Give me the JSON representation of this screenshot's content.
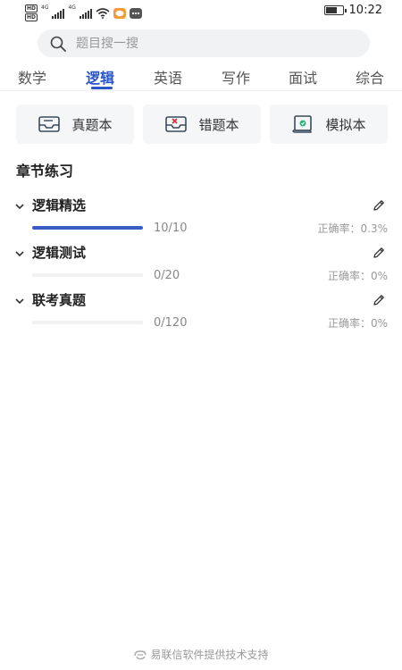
{
  "status_bar": {
    "hd1": "HD",
    "hd2": "HD",
    "net1": "4G",
    "net2": "4G",
    "time": "10:22",
    "battery_level": 0.7,
    "icons": [
      "signal-icon",
      "wifi-icon",
      "message-app-icon",
      "chat-app-icon",
      "battery-icon"
    ]
  },
  "search": {
    "placeholder": "题目搜一搜"
  },
  "tabs": [
    {
      "label": "数学",
      "active": false
    },
    {
      "label": "逻辑",
      "active": true
    },
    {
      "label": "英语",
      "active": false
    },
    {
      "label": "写作",
      "active": false
    },
    {
      "label": "面试",
      "active": false
    },
    {
      "label": "综合",
      "active": false
    }
  ],
  "quick_actions": [
    {
      "label": "真题本",
      "icon": "inbox-icon"
    },
    {
      "label": "错题本",
      "icon": "error-inbox-icon"
    },
    {
      "label": "模拟本",
      "icon": "scroll-icon"
    }
  ],
  "section_title": "章节练习",
  "chapters": [
    {
      "title": "逻辑精选",
      "count": "10/10",
      "progress": 1.0,
      "accuracy": "正确率：0.3%"
    },
    {
      "title": "逻辑测试",
      "count": "0/20",
      "progress": 0.0,
      "accuracy": "正确率：0%"
    },
    {
      "title": "联考真题",
      "count": "0/120",
      "progress": 0.0,
      "accuracy": "正确率：0%"
    }
  ],
  "footer": {
    "text": "易联信软件提供技术支持",
    "icon": "company-logo-icon"
  },
  "colors": {
    "accent": "#2a55c8",
    "progress_fill": "#3a5cc5",
    "track": "#f1f1f1"
  }
}
